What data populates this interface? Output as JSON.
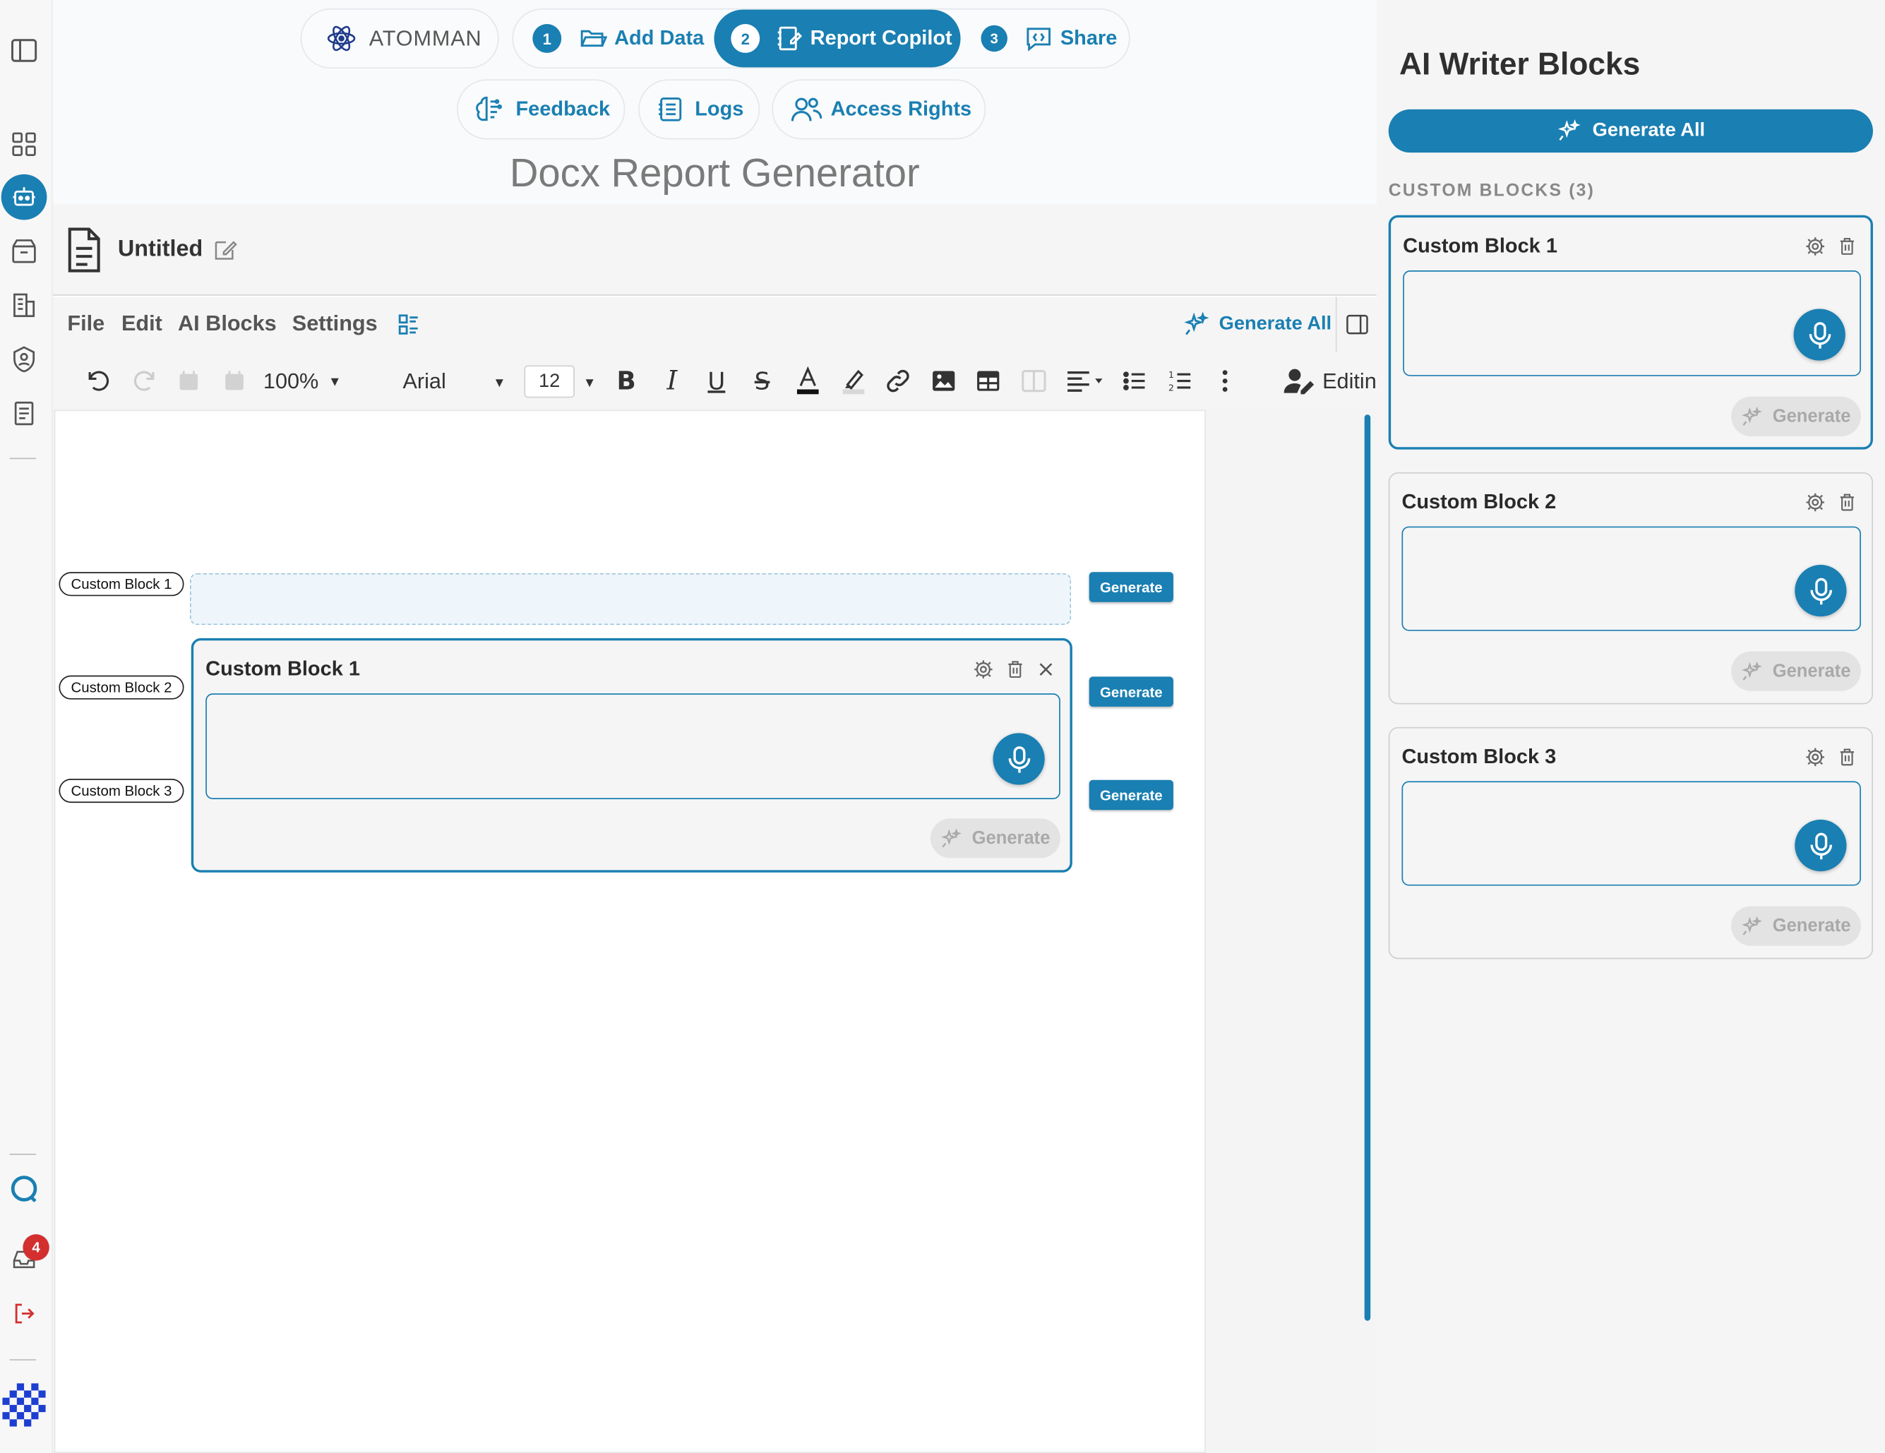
{
  "header": {
    "brand": "ATOMMAN",
    "steps": [
      {
        "num": "1",
        "label": "Add Data"
      },
      {
        "num": "2",
        "label": "Report Copilot"
      },
      {
        "num": "3",
        "label": "Share"
      }
    ],
    "secondary": [
      {
        "label": "Feedback"
      },
      {
        "label": "Logs"
      },
      {
        "label": "Access Rights"
      }
    ],
    "page_title": "Docx Report Generator"
  },
  "document": {
    "name": "Untitled"
  },
  "menubar": {
    "items": [
      "File",
      "Edit",
      "AI Blocks",
      "Settings"
    ],
    "generate_all": "Generate All"
  },
  "toolbar": {
    "zoom": "100%",
    "font": "Arial",
    "font_size": "12",
    "mode": "Editin"
  },
  "editor": {
    "tags": [
      "Custom Block 1",
      "Custom Block 2",
      "Custom Block 3"
    ],
    "generate_label": "Generate",
    "popup": {
      "title": "Custom Block 1",
      "generate": "Generate"
    }
  },
  "rail": {
    "badge": "4"
  },
  "panel": {
    "title": "AI Writer Blocks",
    "generate_all": "Generate All",
    "section_label": "CUSTOM BLOCKS (3)",
    "blocks": [
      {
        "title": "Custom Block 1",
        "generate": "Generate"
      },
      {
        "title": "Custom Block 2",
        "generate": "Generate"
      },
      {
        "title": "Custom Block 3",
        "generate": "Generate"
      }
    ]
  },
  "colors": {
    "accent": "#1a7fb2",
    "badge": "#d32f2f"
  }
}
